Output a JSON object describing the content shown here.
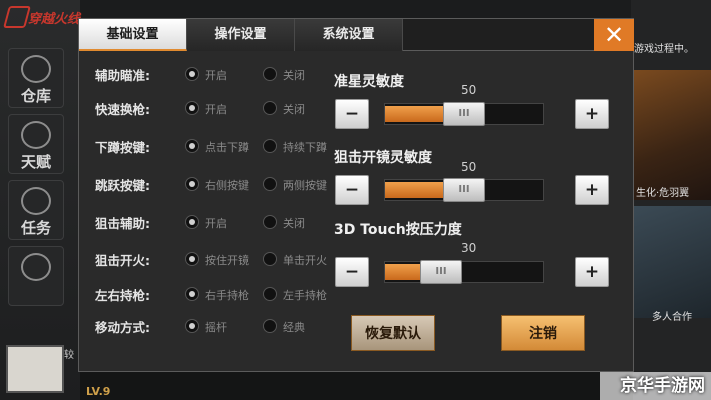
{
  "background": {
    "logo_text": "穿越火线",
    "side_buttons": [
      "仓库",
      "天赋",
      "任务"
    ],
    "right_notice": "游戏过程中。",
    "captions": [
      "生化·危羽翼",
      "多人合作"
    ],
    "ladder_label": "较",
    "level": "LV.9"
  },
  "tabs": [
    {
      "label": "基础设置",
      "active": true
    },
    {
      "label": "操作设置",
      "active": false
    },
    {
      "label": "系统设置",
      "active": false
    }
  ],
  "close_label": "✕",
  "settings": [
    {
      "label": "辅助瞄准:",
      "opt1": "开启",
      "opt2": "关闭",
      "selected": 1
    },
    {
      "label": "快速换枪:",
      "opt1": "开启",
      "opt2": "关闭",
      "selected": 1
    },
    {
      "label": "下蹲按键:",
      "opt1": "点击下蹲",
      "opt2": "持续下蹲",
      "selected": 1
    },
    {
      "label": "跳跃按键:",
      "opt1": "右侧按键",
      "opt2": "两侧按键",
      "selected": 1
    },
    {
      "label": "狙击辅助:",
      "opt1": "开启",
      "opt2": "关闭",
      "selected": 1
    },
    {
      "label": "狙击开火:",
      "opt1": "按住开镜",
      "opt2": "单击开火",
      "selected": 1
    },
    {
      "label": "左右持枪:",
      "opt1": "右手持枪",
      "opt2": "左手持枪",
      "selected": 1
    },
    {
      "label": "移动方式:",
      "opt1": "摇杆",
      "opt2": "经典",
      "selected": 1
    }
  ],
  "sliders": [
    {
      "title": "准星灵敏度",
      "value": "50",
      "fraction": 0.5
    },
    {
      "title": "狙击开镜灵敏度",
      "value": "50",
      "fraction": 0.5
    },
    {
      "title": "3D Touch按压力度",
      "value": "30",
      "fraction": 0.3
    }
  ],
  "minus_label": "−",
  "plus_label": "+",
  "thumb_label": "III",
  "reset_label": "恢复默认",
  "logout_label": "注销",
  "watermark": "京华手游网"
}
